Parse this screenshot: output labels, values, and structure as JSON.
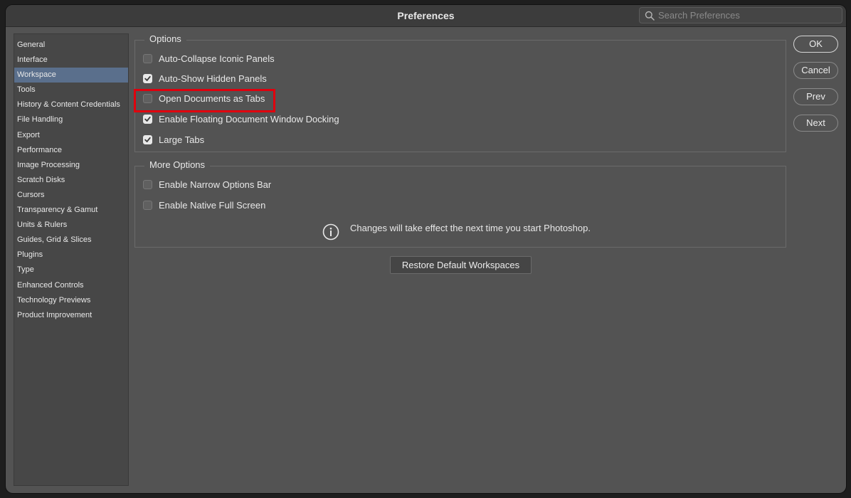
{
  "window": {
    "title": "Preferences"
  },
  "search": {
    "placeholder": "Search Preferences",
    "icon": "search-icon"
  },
  "sidebar": {
    "items": [
      {
        "label": "General"
      },
      {
        "label": "Interface"
      },
      {
        "label": "Workspace",
        "selected": true
      },
      {
        "label": "Tools"
      },
      {
        "label": "History & Content Credentials"
      },
      {
        "label": "File Handling"
      },
      {
        "label": "Export"
      },
      {
        "label": "Performance"
      },
      {
        "label": "Image Processing"
      },
      {
        "label": "Scratch Disks"
      },
      {
        "label": "Cursors"
      },
      {
        "label": "Transparency & Gamut"
      },
      {
        "label": "Units & Rulers"
      },
      {
        "label": "Guides, Grid & Slices"
      },
      {
        "label": "Plugins"
      },
      {
        "label": "Type"
      },
      {
        "label": "Enhanced Controls"
      },
      {
        "label": "Technology Previews"
      },
      {
        "label": "Product Improvement"
      }
    ]
  },
  "options": {
    "legend": "Options",
    "items": [
      {
        "label": "Auto-Collapse Iconic Panels",
        "checked": false
      },
      {
        "label": "Auto-Show Hidden Panels",
        "checked": true
      },
      {
        "label": "Open Documents as Tabs",
        "checked": false
      },
      {
        "label": "Enable Floating Document Window Docking",
        "checked": true
      },
      {
        "label": "Large Tabs",
        "checked": true
      }
    ]
  },
  "more_options": {
    "legend": "More Options",
    "items": [
      {
        "label": "Enable Narrow Options Bar",
        "checked": false
      },
      {
        "label": "Enable Native Full Screen",
        "checked": false
      }
    ],
    "info": {
      "icon": "info-icon",
      "text": "Changes will take effect the next time you start Photoshop."
    }
  },
  "restore_button": {
    "label": "Restore Default Workspaces"
  },
  "buttons": {
    "ok": "OK",
    "cancel": "Cancel",
    "prev": "Prev",
    "next": "Next"
  },
  "colors": {
    "window_bg": "#535353",
    "selected_item": "#5a6f8c",
    "highlight": "#e0000d"
  }
}
